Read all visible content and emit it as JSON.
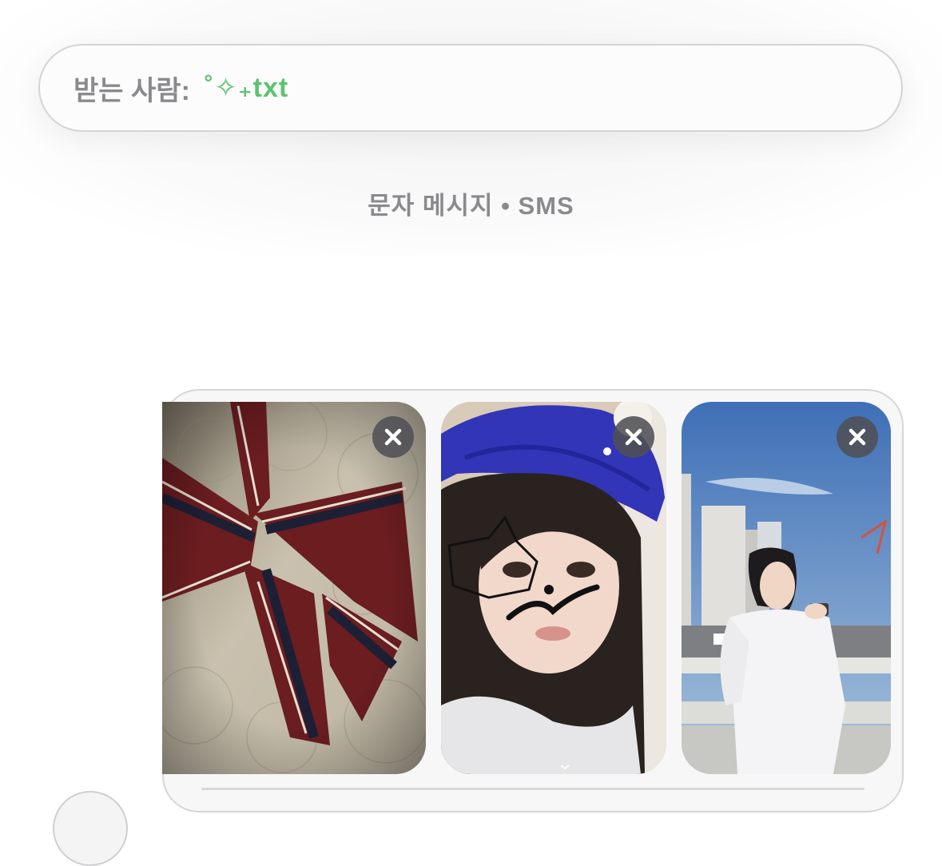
{
  "recipient": {
    "label": "받는 사람:",
    "value": "˚✧₊txt"
  },
  "conversation": {
    "service_label": "문자 메시지 • SMS"
  },
  "attachments": [
    {
      "name": "photo-bow-ribbon"
    },
    {
      "name": "photo-selfie-cap"
    },
    {
      "name": "photo-city-camera"
    }
  ],
  "colors": {
    "recipient_accent": "#5cc36e",
    "secondary_text": "#8a8a8e",
    "remove_button_bg": "#505054"
  }
}
